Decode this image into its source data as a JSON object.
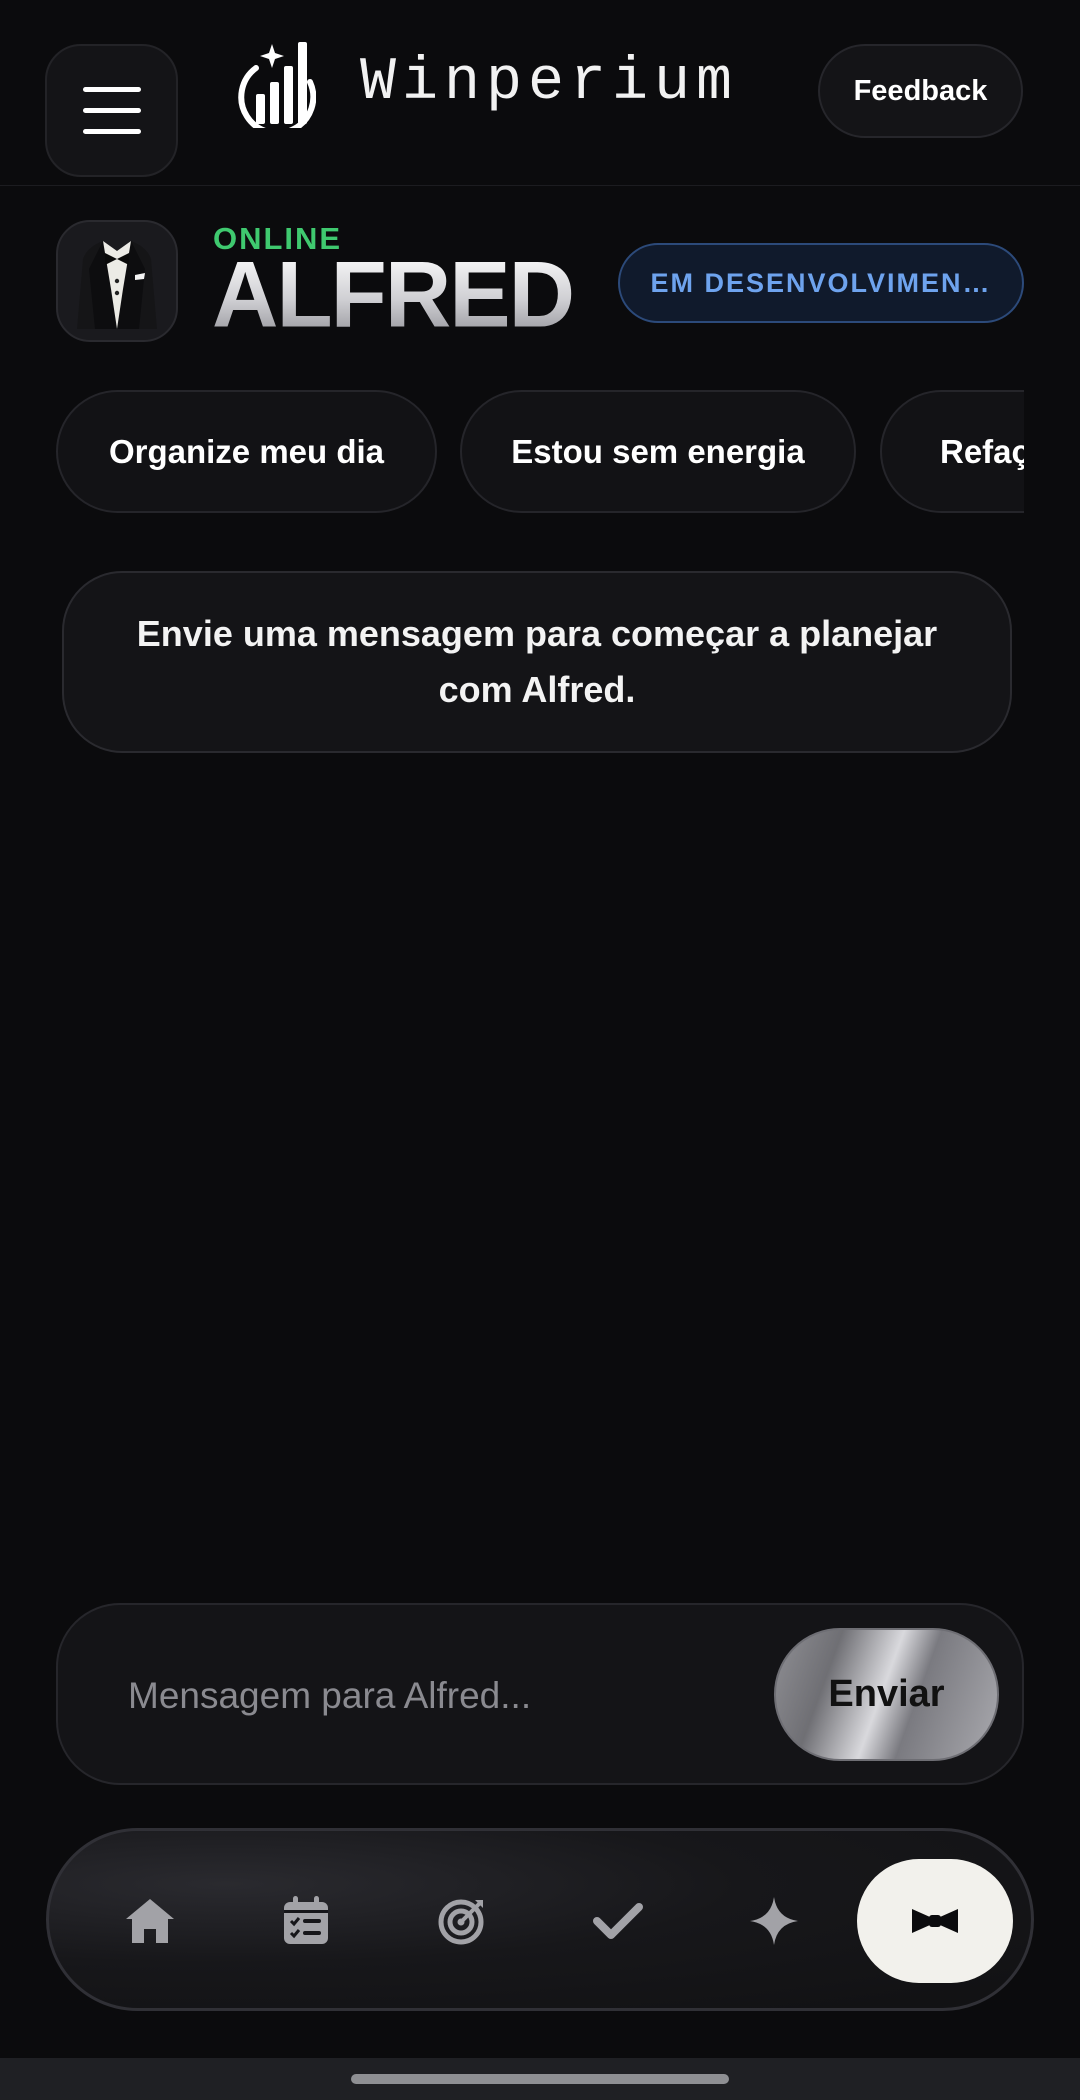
{
  "header": {
    "brand": "Winperium",
    "feedback_label": "Feedback",
    "menu_icon": "hamburger-menu-icon",
    "logo_icon": "winperium-logo-icon"
  },
  "agent": {
    "status": "ONLINE",
    "name": "ALFRED",
    "badge": "EM DESENVOLVIMEN…",
    "avatar_icon": "tuxedo-icon"
  },
  "quick_prompts": [
    {
      "label": "Organize meu dia"
    },
    {
      "label": "Estou sem energia"
    },
    {
      "label": "Refaç"
    }
  ],
  "chat": {
    "empty_message": "Envie uma mensagem para começar a planejar com Alfred."
  },
  "composer": {
    "placeholder": "Mensagem para Alfred...",
    "value": "",
    "send_label": "Enviar"
  },
  "nav": {
    "items": [
      {
        "icon": "home-icon"
      },
      {
        "icon": "calendar-checklist-icon"
      },
      {
        "icon": "target-icon"
      },
      {
        "icon": "check-icon"
      },
      {
        "icon": "sparkle-icon"
      },
      {
        "icon": "bowtie-icon",
        "active": true
      }
    ]
  },
  "colors": {
    "background": "#0b0b0d",
    "online_green": "#3fc96f",
    "badge_blue": "#6ea3ee",
    "active_nav": "#f2f1ec"
  }
}
